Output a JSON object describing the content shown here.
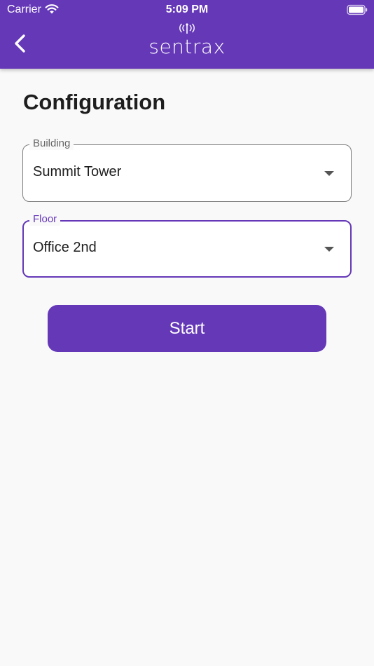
{
  "status_bar": {
    "carrier": "Carrier",
    "time": "5:09 PM",
    "wifi_icon": "wifi-icon",
    "battery_icon": "battery-icon"
  },
  "header": {
    "logo_text": "sentrax",
    "back_icon": "chevron-left-icon",
    "background_color": "#6538b8"
  },
  "page": {
    "title": "Configuration"
  },
  "form": {
    "building": {
      "label": "Building",
      "value": "Summit Tower"
    },
    "floor": {
      "label": "Floor",
      "value": "Office 2nd"
    },
    "start_label": "Start"
  },
  "colors": {
    "accent": "#6538b8",
    "background": "#f9f9f9",
    "text": "#1e1e1e"
  }
}
